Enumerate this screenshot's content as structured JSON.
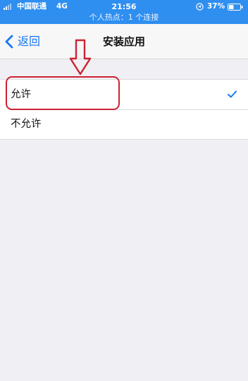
{
  "status_bar": {
    "carrier": "中国联通",
    "network": "4G",
    "time": "21:56",
    "battery": "37%",
    "hotspot": "个人热点：1 个连接"
  },
  "nav": {
    "back_label": "返回",
    "title": "安装应用"
  },
  "options": [
    {
      "label": "允许",
      "selected": true
    },
    {
      "label": "不允许",
      "selected": false
    }
  ],
  "colors": {
    "status_bar": "#2f8ff0",
    "accent": "#1878f3",
    "highlight": "#cc2233"
  }
}
